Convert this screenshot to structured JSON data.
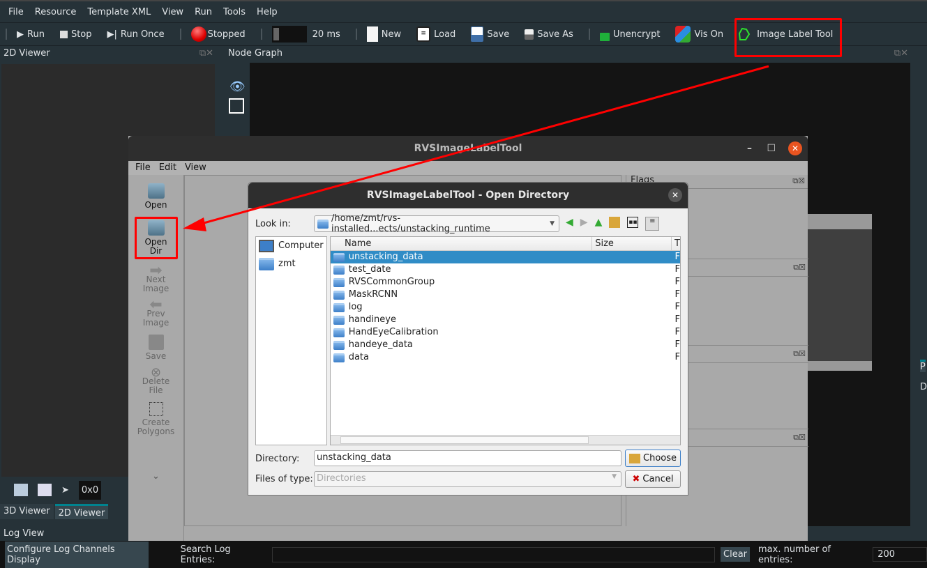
{
  "menu": [
    "File",
    "Resource",
    "Template XML",
    "View",
    "Run",
    "Tools",
    "Help"
  ],
  "toolbar": {
    "run": "Run",
    "stop": "Stop",
    "run_once": "Run Once",
    "status": "Stopped",
    "interval": "20 ms",
    "new": "New",
    "load": "Load",
    "save": "Save",
    "save_as": "Save As",
    "unencrypt": "Unencrypt",
    "vis": "Vis On",
    "image_label_tool": "Image Label Tool"
  },
  "panels": {
    "viewer2d": "2D Viewer",
    "node_graph": "Node Graph",
    "coords": "0x0",
    "tab3d": "3D Viewer",
    "tab2d": "2D Viewer",
    "right_p": "P",
    "right_d": "D",
    "log_view": "Log View"
  },
  "labeltool": {
    "title": "RVSImageLabelTool",
    "menu": [
      "File",
      "Edit",
      "View"
    ],
    "side": [
      {
        "label": "Open",
        "enabled": true
      },
      {
        "label": "Open Dir",
        "enabled": true
      },
      {
        "label": "Next Image",
        "enabled": false
      },
      {
        "label": "Prev Image",
        "enabled": false
      },
      {
        "label": "Save",
        "enabled": false
      },
      {
        "label": "Delete File",
        "enabled": false
      },
      {
        "label": "Create Polygons",
        "enabled": false
      }
    ],
    "flags": "Flags"
  },
  "dialog": {
    "title": "RVSImageLabelTool - Open Directory",
    "look_in_label": "Look in:",
    "look_in": "/home/zmt/rvs-installed...ects/unstacking_runtime",
    "places": [
      "Computer",
      "zmt"
    ],
    "columns": [
      "Name",
      "Size",
      "T"
    ],
    "files": [
      "unstacking_data",
      "test_date",
      "RVSCommonGroup",
      "MaskRCNN",
      "log",
      "handineye",
      "HandEyeCalibration",
      "handeye_data",
      "data"
    ],
    "file_type_char": "F",
    "selected": "unstacking_data",
    "directory_label": "Directory:",
    "directory": "unstacking_data",
    "choose": "Choose",
    "types_label": "Files of type:",
    "types": "Directories",
    "cancel": "Cancel"
  },
  "log": {
    "configure": "Configure Log Channels Display",
    "search_label": "Search Log Entries:",
    "clear": "Clear",
    "max_label": "max. number of entries:",
    "max": "200"
  },
  "colors": {
    "highlight": "#ff0000",
    "selection": "#308cc6",
    "accent": "#00838f"
  }
}
